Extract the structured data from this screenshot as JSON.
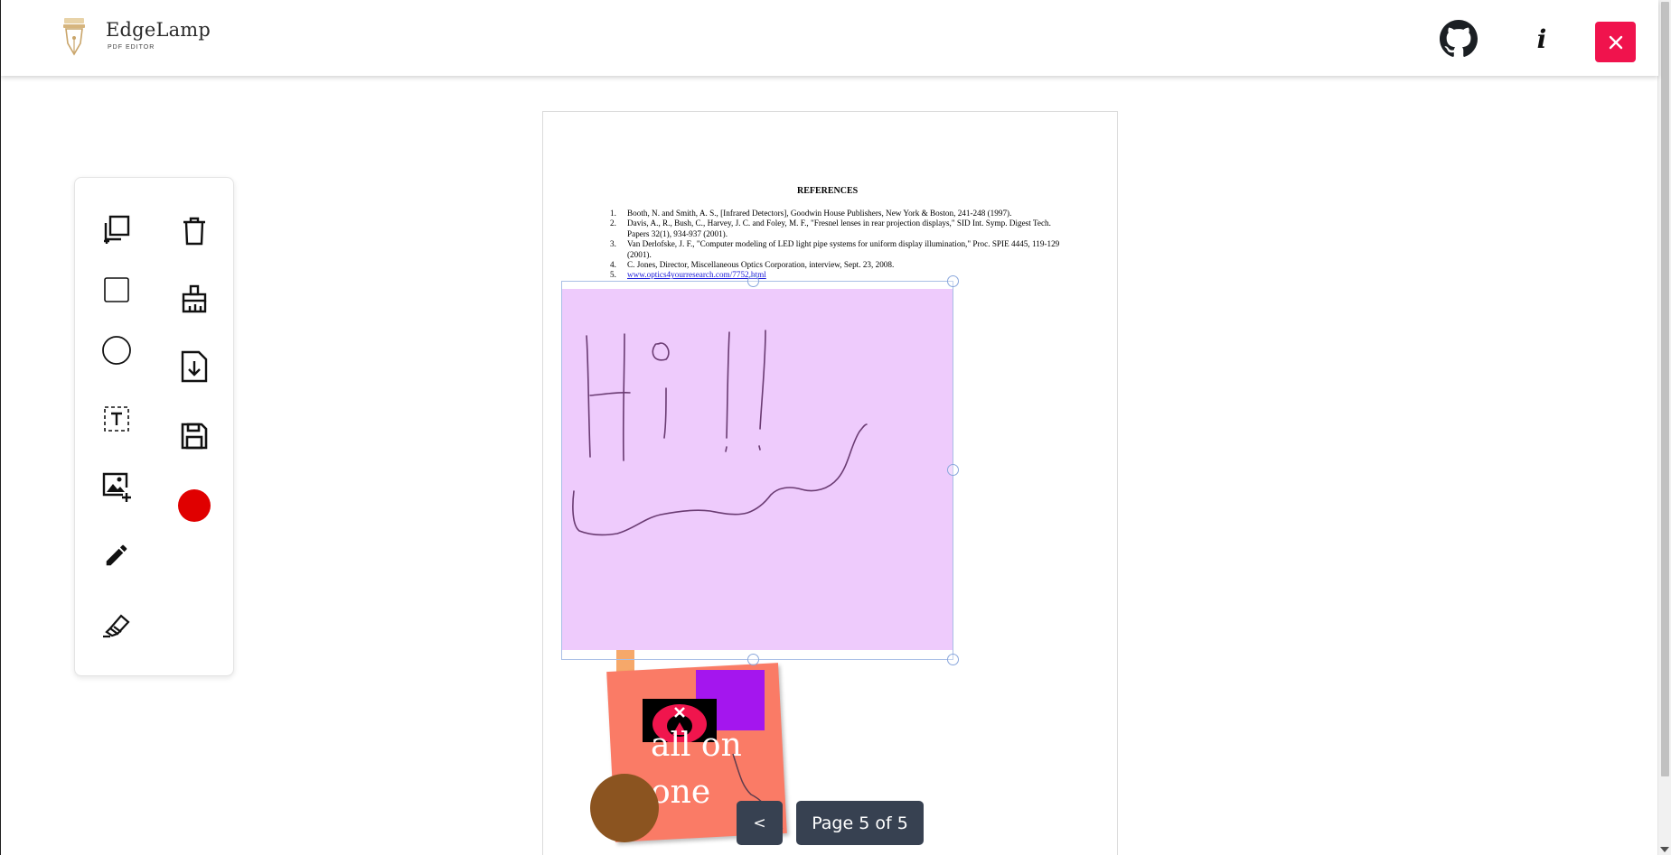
{
  "header": {
    "brand": "EdgeLamp",
    "brand_sub": "PDF EDITOR",
    "github_icon": "github-icon",
    "info_label": "i",
    "close_icon": "close-icon",
    "close_color": "#f0134d"
  },
  "toolbar": {
    "left_tools": [
      "duplicate-page-icon",
      "rectangle-icon",
      "circle-icon",
      "text-box-icon",
      "add-image-icon",
      "pencil-icon",
      "highlighter-icon"
    ],
    "right_tools": [
      "trash-icon",
      "broom-icon",
      "download-icon",
      "save-icon",
      "color-picker"
    ],
    "current_color": "#e00000"
  },
  "document": {
    "title": "REFERENCES",
    "references": [
      {
        "num": "1.",
        "text": "Booth, N. and Smith, A. S., [Infrared Detectors], Goodwin House Publishers, New York & Boston, 241-248 (1997)."
      },
      {
        "num": "2.",
        "text": "Davis, A., R., Bush, C., Harvey, J. C. and Foley, M. F., \"Fresnel lenses in rear projection displays,\" SID Int. Symp. Digest Tech. Papers 32(1), 934-937 (2001)."
      },
      {
        "num": "3.",
        "text": "Van Derlofske, J. F., \"Computer modeling of LED light pipe systems for uniform display illumination,\" Proc. SPIE 4445, 119-129 (2001)."
      },
      {
        "num": "4.",
        "text": "C. Jones, Director, Miscellaneous Optics Corporation, interview, Sept. 23, 2008."
      },
      {
        "num": "5.",
        "text": "www.optics4yourresearch.com/7752.html"
      }
    ]
  },
  "annotations": {
    "drawing_bg": "#eecbfc",
    "sticker_text": "all on one"
  },
  "pagination": {
    "prev_label": "<",
    "page_label": "Page 5 of 5"
  }
}
